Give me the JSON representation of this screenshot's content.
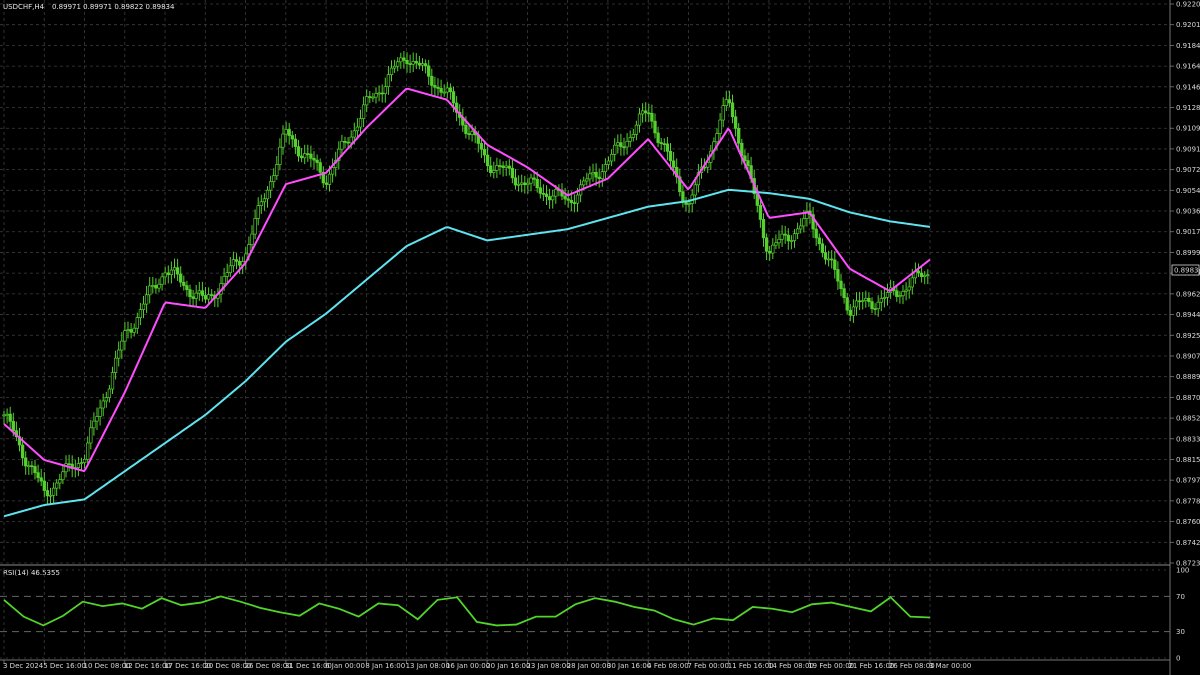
{
  "window": {
    "symbol_title": "USDCHF,H4",
    "ohlc_values": "0.89971 0.89971 0.89822 0.89834",
    "current_price_label": "0.89834",
    "rsi_title": "RSI(14) 46.5355"
  },
  "colors": {
    "background": "#000000",
    "grid": "#3c3c3c",
    "candle_up": "#56d02f",
    "candle_down": "#56d02f",
    "ma_fast": "#ff4dff",
    "ma_slow": "#5ee3ef",
    "rsi_line": "#52d42b",
    "axis_text": "#d8d8d8"
  },
  "chart_data": [
    {
      "type": "candlestick",
      "name": "USDCHF,H4",
      "y_axis_ticks": [
        "0.92200",
        "0.92015",
        "0.91845",
        "0.91645",
        "0.91465",
        "0.91280",
        "0.91095",
        "0.90910",
        "0.90725",
        "0.90545",
        "0.90360",
        "0.90175",
        "0.89990",
        "0.89805",
        "0.89625",
        "0.89440",
        "0.89255",
        "0.89075",
        "0.88890",
        "0.88705",
        "0.88520",
        "0.88335",
        "0.88155",
        "0.87970",
        "0.87785",
        "0.87600",
        "0.87420",
        "0.87235"
      ],
      "ylim": [
        0.87235,
        0.922
      ],
      "x_axis_ticks": [
        "3 Dec 2024",
        "5 Dec 16:00",
        "10 Dec 08:00",
        "12 Dec 16:00",
        "17 Dec 16:00",
        "20 Dec 08:00",
        "26 Dec 08:00",
        "31 Dec 16:00",
        "6 Jan 00:00",
        "8 Jan 16:00",
        "13 Jan 08:00",
        "16 Jan 00:00",
        "20 Jan 16:00",
        "23 Jan 08:00",
        "28 Jan 00:00",
        "30 Jan 16:00",
        "4 Feb 08:00",
        "7 Feb 00:00",
        "11 Feb 16:00",
        "14 Feb 08:00",
        "19 Feb 00:00",
        "21 Feb 16:00",
        "26 Feb 08:00",
        "3 Mar 00:00"
      ],
      "close_path": [
        [
          "3 Dec 2024",
          0.8855
        ],
        [
          "5 Dec 16:00",
          0.8785
        ],
        [
          "10 Dec 08:00",
          0.882
        ],
        [
          "12 Dec 16:00",
          0.8925
        ],
        [
          "17 Dec 16:00",
          0.8985
        ],
        [
          "20 Dec 08:00",
          0.8955
        ],
        [
          "26 Dec 08:00",
          0.9
        ],
        [
          "31 Dec 16:00",
          0.9105
        ],
        [
          "6 Jan 00:00",
          0.9065
        ],
        [
          "8 Jan 16:00",
          0.913
        ],
        [
          "13 Jan 08:00",
          0.9175
        ],
        [
          "16 Jan 00:00",
          0.914
        ],
        [
          "20 Jan 16:00",
          0.908
        ],
        [
          "23 Jan 08:00",
          0.906
        ],
        [
          "28 Jan 00:00",
          0.9045
        ],
        [
          "30 Jan 16:00",
          0.908
        ],
        [
          "4 Feb 08:00",
          0.9125
        ],
        [
          "7 Feb 00:00",
          0.904
        ],
        [
          "11 Feb 16:00",
          0.9135
        ],
        [
          "14 Feb 08:00",
          0.9
        ],
        [
          "19 Feb 00:00",
          0.903
        ],
        [
          "21 Feb 16:00",
          0.895
        ],
        [
          "26 Feb 08:00",
          0.896
        ],
        [
          "3 Mar 00:00",
          0.89834
        ]
      ],
      "ma_fast": [
        [
          "3 Dec 2024",
          0.8847
        ],
        [
          "5 Dec 16:00",
          0.8815
        ],
        [
          "10 Dec 08:00",
          0.8805
        ],
        [
          "12 Dec 16:00",
          0.8875
        ],
        [
          "17 Dec 16:00",
          0.8955
        ],
        [
          "20 Dec 08:00",
          0.895
        ],
        [
          "26 Dec 08:00",
          0.899
        ],
        [
          "31 Dec 16:00",
          0.906
        ],
        [
          "6 Jan 00:00",
          0.907
        ],
        [
          "8 Jan 16:00",
          0.911
        ],
        [
          "13 Jan 08:00",
          0.9145
        ],
        [
          "16 Jan 00:00",
          0.9135
        ],
        [
          "20 Jan 16:00",
          0.9095
        ],
        [
          "23 Jan 08:00",
          0.9075
        ],
        [
          "28 Jan 00:00",
          0.905
        ],
        [
          "30 Jan 16:00",
          0.9065
        ],
        [
          "4 Feb 08:00",
          0.91
        ],
        [
          "7 Feb 00:00",
          0.9055
        ],
        [
          "11 Feb 16:00",
          0.911
        ],
        [
          "14 Feb 08:00",
          0.903
        ],
        [
          "19 Feb 00:00",
          0.9035
        ],
        [
          "21 Feb 16:00",
          0.8985
        ],
        [
          "26 Feb 08:00",
          0.8965
        ],
        [
          "3 Mar 00:00",
          0.8993
        ]
      ],
      "ma_slow": [
        [
          "3 Dec 2024",
          0.8765
        ],
        [
          "5 Dec 16:00",
          0.8775
        ],
        [
          "10 Dec 08:00",
          0.878
        ],
        [
          "12 Dec 16:00",
          0.8805
        ],
        [
          "17 Dec 16:00",
          0.883
        ],
        [
          "20 Dec 08:00",
          0.8855
        ],
        [
          "26 Dec 08:00",
          0.8885
        ],
        [
          "31 Dec 16:00",
          0.892
        ],
        [
          "6 Jan 00:00",
          0.8945
        ],
        [
          "8 Jan 16:00",
          0.8975
        ],
        [
          "13 Jan 08:00",
          0.9005
        ],
        [
          "16 Jan 00:00",
          0.9022
        ],
        [
          "20 Jan 16:00",
          0.901
        ],
        [
          "23 Jan 08:00",
          0.9015
        ],
        [
          "28 Jan 00:00",
          0.902
        ],
        [
          "30 Jan 16:00",
          0.903
        ],
        [
          "4 Feb 08:00",
          0.904
        ],
        [
          "7 Feb 00:00",
          0.9045
        ],
        [
          "11 Feb 16:00",
          0.9055
        ],
        [
          "14 Feb 08:00",
          0.9052
        ],
        [
          "19 Feb 00:00",
          0.9047
        ],
        [
          "21 Feb 16:00",
          0.9035
        ],
        [
          "26 Feb 08:00",
          0.9027
        ],
        [
          "3 Mar 00:00",
          0.9022
        ]
      ]
    },
    {
      "type": "line",
      "name": "RSI(14) 46.5355",
      "y_axis_ticks": [
        "100",
        "70",
        "30",
        "0"
      ],
      "ylim": [
        0,
        100
      ],
      "levels": [
        70,
        30
      ],
      "values": [
        66,
        47,
        37,
        48,
        64,
        59,
        62,
        56,
        68,
        60,
        63,
        70,
        64,
        57,
        52,
        48,
        62,
        56,
        47,
        62,
        60,
        44,
        66,
        69,
        41,
        37,
        38,
        47,
        47,
        61,
        68,
        64,
        58,
        54,
        44,
        38,
        45,
        43,
        58,
        56,
        52,
        61,
        63,
        58,
        53,
        69,
        47,
        46
      ]
    }
  ]
}
